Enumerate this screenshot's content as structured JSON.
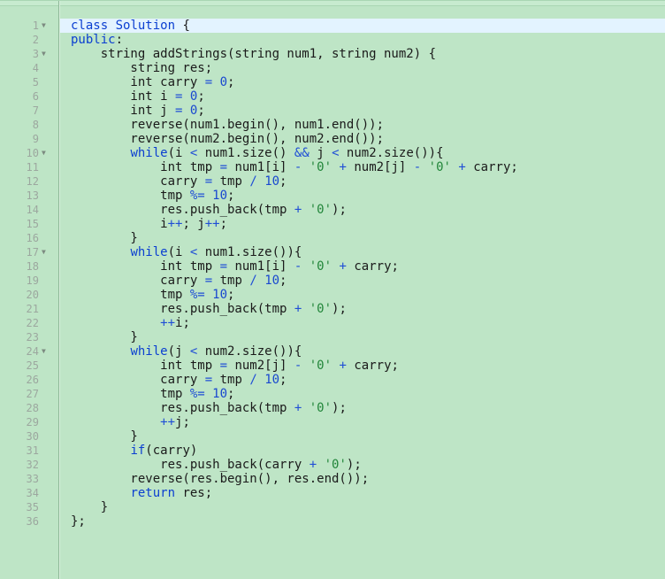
{
  "editor": {
    "active_line": 1,
    "lines": [
      {
        "no": "1",
        "fold": true,
        "tokens": [
          [
            "kw",
            "class"
          ],
          [
            "plain",
            " "
          ],
          [
            "kw",
            "Solution"
          ],
          [
            "plain",
            " {"
          ]
        ]
      },
      {
        "no": "2",
        "fold": false,
        "tokens": [
          [
            "kw",
            "public"
          ],
          [
            "plain",
            ":"
          ]
        ]
      },
      {
        "no": "3",
        "fold": true,
        "tokens": [
          [
            "plain",
            "    string addStrings(string num1, string num2) {"
          ]
        ]
      },
      {
        "no": "4",
        "fold": false,
        "tokens": [
          [
            "plain",
            "        string res;"
          ]
        ]
      },
      {
        "no": "5",
        "fold": false,
        "tokens": [
          [
            "plain",
            "        int carry "
          ],
          [
            "op",
            "="
          ],
          [
            "plain",
            " "
          ],
          [
            "num",
            "0"
          ],
          [
            "plain",
            ";"
          ]
        ]
      },
      {
        "no": "6",
        "fold": false,
        "tokens": [
          [
            "plain",
            "        int i "
          ],
          [
            "op",
            "="
          ],
          [
            "plain",
            " "
          ],
          [
            "num",
            "0"
          ],
          [
            "plain",
            ";"
          ]
        ]
      },
      {
        "no": "7",
        "fold": false,
        "tokens": [
          [
            "plain",
            "        int j "
          ],
          [
            "op",
            "="
          ],
          [
            "plain",
            " "
          ],
          [
            "num",
            "0"
          ],
          [
            "plain",
            ";"
          ]
        ]
      },
      {
        "no": "8",
        "fold": false,
        "tokens": [
          [
            "plain",
            "        reverse(num1.begin(), num1.end());"
          ]
        ]
      },
      {
        "no": "9",
        "fold": false,
        "tokens": [
          [
            "plain",
            "        reverse(num2.begin(), num2.end());"
          ]
        ]
      },
      {
        "no": "10",
        "fold": true,
        "tokens": [
          [
            "plain",
            "        "
          ],
          [
            "kw",
            "while"
          ],
          [
            "plain",
            "(i "
          ],
          [
            "op",
            "<"
          ],
          [
            "plain",
            " num1.size() "
          ],
          [
            "op",
            "&&"
          ],
          [
            "plain",
            " j "
          ],
          [
            "op",
            "<"
          ],
          [
            "plain",
            " num2.size()){"
          ]
        ]
      },
      {
        "no": "11",
        "fold": false,
        "tokens": [
          [
            "plain",
            "            int tmp "
          ],
          [
            "op",
            "="
          ],
          [
            "plain",
            " num1[i] "
          ],
          [
            "op",
            "-"
          ],
          [
            "plain",
            " "
          ],
          [
            "str",
            "'0'"
          ],
          [
            "plain",
            " "
          ],
          [
            "op",
            "+"
          ],
          [
            "plain",
            " num2[j] "
          ],
          [
            "op",
            "-"
          ],
          [
            "plain",
            " "
          ],
          [
            "str",
            "'0'"
          ],
          [
            "plain",
            " "
          ],
          [
            "op",
            "+"
          ],
          [
            "plain",
            " carry;"
          ]
        ]
      },
      {
        "no": "12",
        "fold": false,
        "tokens": [
          [
            "plain",
            "            carry "
          ],
          [
            "op",
            "="
          ],
          [
            "plain",
            " tmp "
          ],
          [
            "op",
            "/"
          ],
          [
            "plain",
            " "
          ],
          [
            "num",
            "10"
          ],
          [
            "plain",
            ";"
          ]
        ]
      },
      {
        "no": "13",
        "fold": false,
        "tokens": [
          [
            "plain",
            "            tmp "
          ],
          [
            "op",
            "%="
          ],
          [
            "plain",
            " "
          ],
          [
            "num",
            "10"
          ],
          [
            "plain",
            ";"
          ]
        ]
      },
      {
        "no": "14",
        "fold": false,
        "tokens": [
          [
            "plain",
            "            res.push_back(tmp "
          ],
          [
            "op",
            "+"
          ],
          [
            "plain",
            " "
          ],
          [
            "str",
            "'0'"
          ],
          [
            "plain",
            ");"
          ]
        ]
      },
      {
        "no": "15",
        "fold": false,
        "tokens": [
          [
            "plain",
            "            i"
          ],
          [
            "op",
            "++"
          ],
          [
            "plain",
            "; j"
          ],
          [
            "op",
            "++"
          ],
          [
            "plain",
            ";"
          ]
        ]
      },
      {
        "no": "16",
        "fold": false,
        "tokens": [
          [
            "plain",
            "        }"
          ]
        ]
      },
      {
        "no": "17",
        "fold": true,
        "tokens": [
          [
            "plain",
            "        "
          ],
          [
            "kw",
            "while"
          ],
          [
            "plain",
            "(i "
          ],
          [
            "op",
            "<"
          ],
          [
            "plain",
            " num1.size()){"
          ]
        ]
      },
      {
        "no": "18",
        "fold": false,
        "tokens": [
          [
            "plain",
            "            int tmp "
          ],
          [
            "op",
            "="
          ],
          [
            "plain",
            " num1[i] "
          ],
          [
            "op",
            "-"
          ],
          [
            "plain",
            " "
          ],
          [
            "str",
            "'0'"
          ],
          [
            "plain",
            " "
          ],
          [
            "op",
            "+"
          ],
          [
            "plain",
            " carry;"
          ]
        ]
      },
      {
        "no": "19",
        "fold": false,
        "tokens": [
          [
            "plain",
            "            carry "
          ],
          [
            "op",
            "="
          ],
          [
            "plain",
            " tmp "
          ],
          [
            "op",
            "/"
          ],
          [
            "plain",
            " "
          ],
          [
            "num",
            "10"
          ],
          [
            "plain",
            ";"
          ]
        ]
      },
      {
        "no": "20",
        "fold": false,
        "tokens": [
          [
            "plain",
            "            tmp "
          ],
          [
            "op",
            "%="
          ],
          [
            "plain",
            " "
          ],
          [
            "num",
            "10"
          ],
          [
            "plain",
            ";"
          ]
        ]
      },
      {
        "no": "21",
        "fold": false,
        "tokens": [
          [
            "plain",
            "            res.push_back(tmp "
          ],
          [
            "op",
            "+"
          ],
          [
            "plain",
            " "
          ],
          [
            "str",
            "'0'"
          ],
          [
            "plain",
            ");"
          ]
        ]
      },
      {
        "no": "22",
        "fold": false,
        "tokens": [
          [
            "plain",
            "            "
          ],
          [
            "op",
            "++"
          ],
          [
            "plain",
            "i;"
          ]
        ]
      },
      {
        "no": "23",
        "fold": false,
        "tokens": [
          [
            "plain",
            "        }"
          ]
        ]
      },
      {
        "no": "24",
        "fold": true,
        "tokens": [
          [
            "plain",
            "        "
          ],
          [
            "kw",
            "while"
          ],
          [
            "plain",
            "(j "
          ],
          [
            "op",
            "<"
          ],
          [
            "plain",
            " num2.size()){"
          ]
        ]
      },
      {
        "no": "25",
        "fold": false,
        "tokens": [
          [
            "plain",
            "            int tmp "
          ],
          [
            "op",
            "="
          ],
          [
            "plain",
            " num2[j] "
          ],
          [
            "op",
            "-"
          ],
          [
            "plain",
            " "
          ],
          [
            "str",
            "'0'"
          ],
          [
            "plain",
            " "
          ],
          [
            "op",
            "+"
          ],
          [
            "plain",
            " carry;"
          ]
        ]
      },
      {
        "no": "26",
        "fold": false,
        "tokens": [
          [
            "plain",
            "            carry "
          ],
          [
            "op",
            "="
          ],
          [
            "plain",
            " tmp "
          ],
          [
            "op",
            "/"
          ],
          [
            "plain",
            " "
          ],
          [
            "num",
            "10"
          ],
          [
            "plain",
            ";"
          ]
        ]
      },
      {
        "no": "27",
        "fold": false,
        "tokens": [
          [
            "plain",
            "            tmp "
          ],
          [
            "op",
            "%="
          ],
          [
            "plain",
            " "
          ],
          [
            "num",
            "10"
          ],
          [
            "plain",
            ";"
          ]
        ]
      },
      {
        "no": "28",
        "fold": false,
        "tokens": [
          [
            "plain",
            "            res.push_back(tmp "
          ],
          [
            "op",
            "+"
          ],
          [
            "plain",
            " "
          ],
          [
            "str",
            "'0'"
          ],
          [
            "plain",
            ");"
          ]
        ]
      },
      {
        "no": "29",
        "fold": false,
        "tokens": [
          [
            "plain",
            "            "
          ],
          [
            "op",
            "++"
          ],
          [
            "plain",
            "j;"
          ]
        ]
      },
      {
        "no": "30",
        "fold": false,
        "tokens": [
          [
            "plain",
            "        }"
          ]
        ]
      },
      {
        "no": "31",
        "fold": false,
        "tokens": [
          [
            "plain",
            "        "
          ],
          [
            "kw",
            "if"
          ],
          [
            "plain",
            "(carry)"
          ]
        ]
      },
      {
        "no": "32",
        "fold": false,
        "tokens": [
          [
            "plain",
            "            res.push_back(carry "
          ],
          [
            "op",
            "+"
          ],
          [
            "plain",
            " "
          ],
          [
            "str",
            "'0'"
          ],
          [
            "plain",
            ");"
          ]
        ]
      },
      {
        "no": "33",
        "fold": false,
        "tokens": [
          [
            "plain",
            "        reverse(res.begin(), res.end());"
          ]
        ]
      },
      {
        "no": "34",
        "fold": false,
        "tokens": [
          [
            "plain",
            "        "
          ],
          [
            "kw",
            "return"
          ],
          [
            "plain",
            " res;"
          ]
        ]
      },
      {
        "no": "35",
        "fold": false,
        "tokens": [
          [
            "plain",
            "    }"
          ]
        ]
      },
      {
        "no": "36",
        "fold": false,
        "tokens": [
          [
            "plain",
            "};"
          ]
        ]
      }
    ],
    "fold_icon": "triangle-down-icon",
    "fold_glyph": "▼"
  },
  "colors": {
    "background": "#bee5c6",
    "active_line": "#e3f3ff",
    "keyword": "#0b3fd1",
    "string": "#22863a",
    "number": "#1948d0",
    "line_number": "#9ca79f"
  }
}
